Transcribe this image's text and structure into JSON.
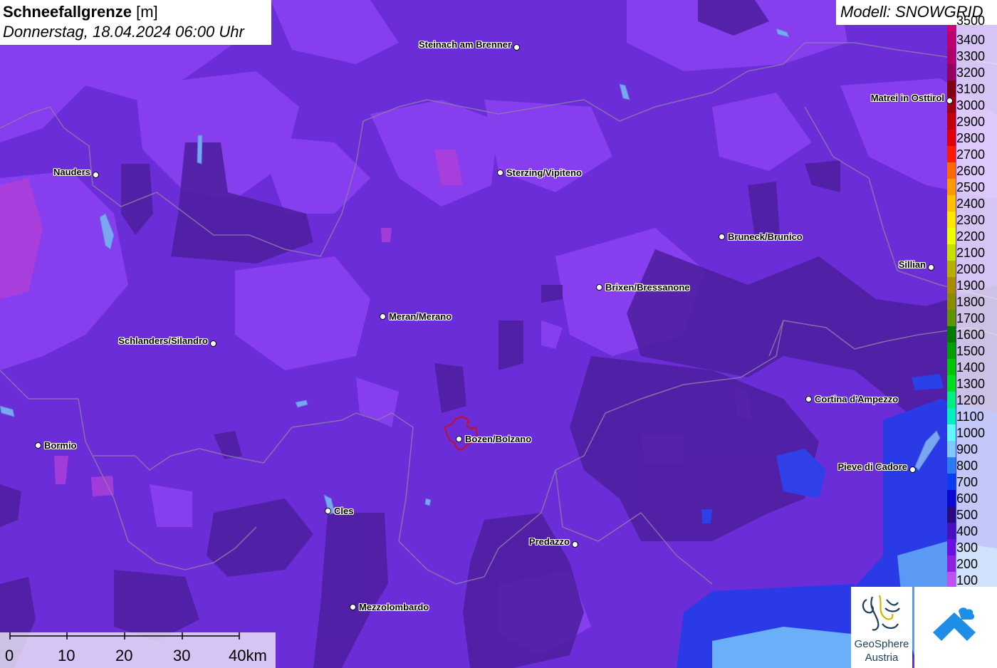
{
  "title": {
    "parameter": "Schneefallgrenze",
    "unit": "[m]",
    "datetime": "Donnerstag, 18.04.2024 06:00 Uhr"
  },
  "model_label": "Modell: SNOWGRID",
  "legend": {
    "top_label": "3500",
    "items": [
      {
        "label": "3400",
        "color": "#c0006a"
      },
      {
        "label": "3300",
        "color": "#b0006a"
      },
      {
        "label": "3200",
        "color": "#96005e"
      },
      {
        "label": "3100",
        "color": "#800010"
      },
      {
        "label": "3000",
        "color": "#a00010"
      },
      {
        "label": "2900",
        "color": "#c0000c"
      },
      {
        "label": "2800",
        "color": "#e00008"
      },
      {
        "label": "2700",
        "color": "#ff1a00"
      },
      {
        "label": "2600",
        "color": "#ff6a00"
      },
      {
        "label": "2500",
        "color": "#ff9a00"
      },
      {
        "label": "2400",
        "color": "#ffc000"
      },
      {
        "label": "2300",
        "color": "#ffe800"
      },
      {
        "label": "2200",
        "color": "#f0ff00"
      },
      {
        "label": "2100",
        "color": "#c8e000"
      },
      {
        "label": "2000",
        "color": "#b8b000"
      },
      {
        "label": "1900",
        "color": "#a88c00"
      },
      {
        "label": "1800",
        "color": "#8c8c00"
      },
      {
        "label": "1700",
        "color": "#5e9400"
      },
      {
        "label": "1600",
        "color": "#007a00"
      },
      {
        "label": "1500",
        "color": "#00a000"
      },
      {
        "label": "1400",
        "color": "#00c800"
      },
      {
        "label": "1300",
        "color": "#00e020"
      },
      {
        "label": "1200",
        "color": "#00f080"
      },
      {
        "label": "1100",
        "color": "#00f0c0"
      },
      {
        "label": "1000",
        "color": "#60f8f8"
      },
      {
        "label": "900",
        "color": "#80c8ff"
      },
      {
        "label": "800",
        "color": "#2a7cf0"
      },
      {
        "label": "700",
        "color": "#0a3cf0"
      },
      {
        "label": "600",
        "color": "#0a0ad0"
      },
      {
        "label": "500",
        "color": "#2a0a80"
      },
      {
        "label": "400",
        "color": "#4a10c0"
      },
      {
        "label": "300",
        "color": "#6a10e0"
      },
      {
        "label": "200",
        "color": "#9020e0"
      },
      {
        "label": "100",
        "color": "#c050f0"
      }
    ]
  },
  "cities": [
    {
      "name": "Steinach am Brenner",
      "side": "left"
    },
    {
      "name": "Nauders",
      "side": "left"
    },
    {
      "name": "Sterzing/Vipiteno",
      "side": "right"
    },
    {
      "name": "Matrei in Osttirol",
      "side": "left"
    },
    {
      "name": "Bruneck/Brunico",
      "side": "right"
    },
    {
      "name": "Sillian",
      "side": "left"
    },
    {
      "name": "Brixen/Bressanone",
      "side": "right"
    },
    {
      "name": "Meran/Merano",
      "side": "right"
    },
    {
      "name": "Schlanders/Silandro",
      "side": "left"
    },
    {
      "name": "Cortina d'Ampezzo",
      "side": "right"
    },
    {
      "name": "Bormio",
      "side": "right"
    },
    {
      "name": "Bozen/Bolzano",
      "side": "right"
    },
    {
      "name": "Pieve di Cadore",
      "side": "left"
    },
    {
      "name": "Cles",
      "side": "right"
    },
    {
      "name": "Predazzo",
      "side": "left"
    },
    {
      "name": "Mezzolombardo",
      "side": "right"
    }
  ],
  "scalebar": {
    "ticks": [
      "0",
      "10",
      "20",
      "30",
      "40km"
    ]
  },
  "logos": {
    "geosphere_line1": "GeoSphere",
    "geosphere_line2": "Austria"
  },
  "colors": {
    "base": "#6a2dd8",
    "light": "#8a3ef0",
    "dark": "#4a1e9a",
    "blue": "#2a38e8",
    "lightblue": "#80c8ff"
  }
}
